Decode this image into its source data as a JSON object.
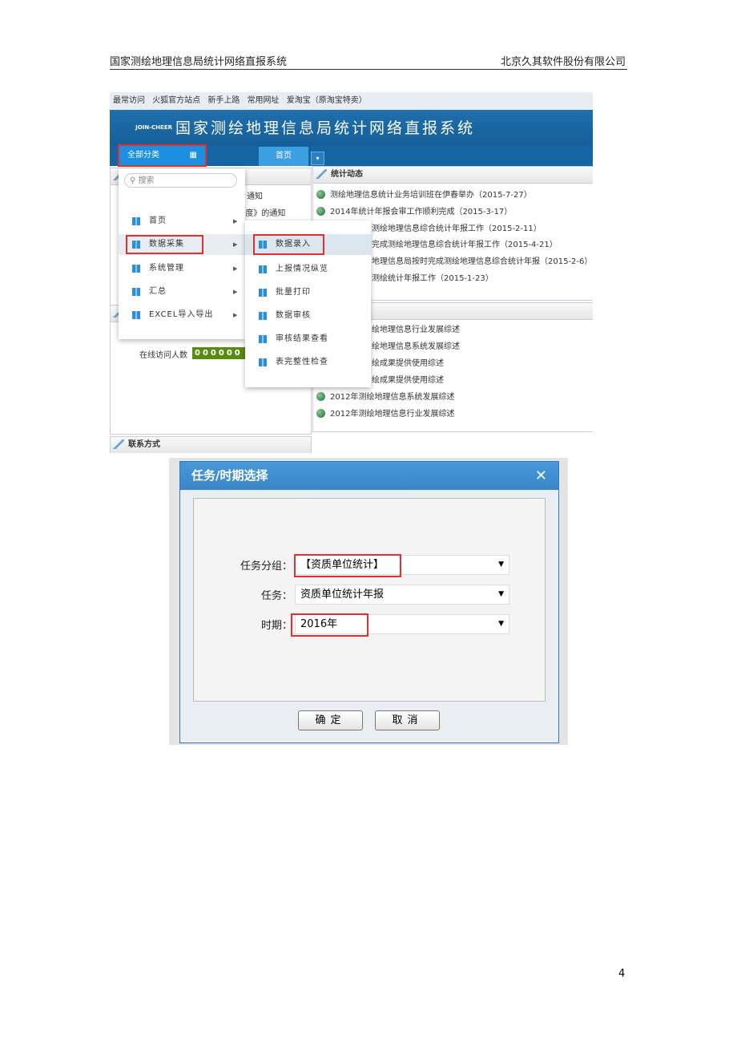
{
  "doc": {
    "header_left": "国家测绘地理信息局统计网络直报系统",
    "header_right": "北京久其软件股份有限公司",
    "page_number": "4"
  },
  "browser": {
    "bookmarks": [
      "最常访问",
      "火狐官方站点",
      "新手上路",
      "常用网址",
      "爱淘宝（原淘宝特卖）"
    ]
  },
  "app": {
    "logo": "JOIN-CHEER",
    "title": "国家测绘地理信息局统计网络直报系统",
    "all_categories": "全部分类",
    "tab_home": "首页"
  },
  "menu": {
    "search_placeholder": "搜索",
    "items": [
      "首页",
      "数据采集",
      "系统管理",
      "汇总",
      "EXCEL导入导出"
    ]
  },
  "submenu": {
    "items": [
      "数据录入",
      "上报情况纵览",
      "批量打印",
      "数据审核",
      "审核结果查看",
      "表完整性检查"
    ]
  },
  "left": {
    "notice_partial": [
      "通知",
      "≤制度》的通知"
    ],
    "online_label": "在线访问人数",
    "online_count": "000000",
    "contact_title": "联系方式"
  },
  "stats": {
    "title": "统计动态",
    "items": [
      "测绘地理信息统计业务培训班在伊春举办（2015-7-27）",
      "2014年统计年报会审工作顺利完成（2015-3-17）",
      "测绘地理信息综合统计年报工作（2015-2-11）",
      "完成测绘地理信息综合统计年报工作（2015-4-21）",
      "地理信息局按时完成测绘地理信息综合统计年报（2015-2-6）",
      "测绘统计年报工作（2015-1-23）"
    ]
  },
  "reports": {
    "items": [
      "绘地理信息行业发展综述",
      "绘地理信息系统发展综述",
      "绘成果提供使用综述",
      "绘成果提供使用综述",
      "2012年测绘地理信息系统发展综述",
      "2012年测绘地理信息行业发展综述"
    ]
  },
  "dialog": {
    "title": "任务/时期选择",
    "close": "✕",
    "group_label": "任务分组：",
    "group_value": "【资质单位统计】",
    "task_label": "任务：",
    "task_value": "资质单位统计年报",
    "period_label": "时期：",
    "period_value": "2016年",
    "ok": "确定",
    "cancel": "取消"
  },
  "colors": {
    "banner": "#1a66a6",
    "highlight": "#e03030",
    "dialog_title": "#3d8fd1"
  }
}
